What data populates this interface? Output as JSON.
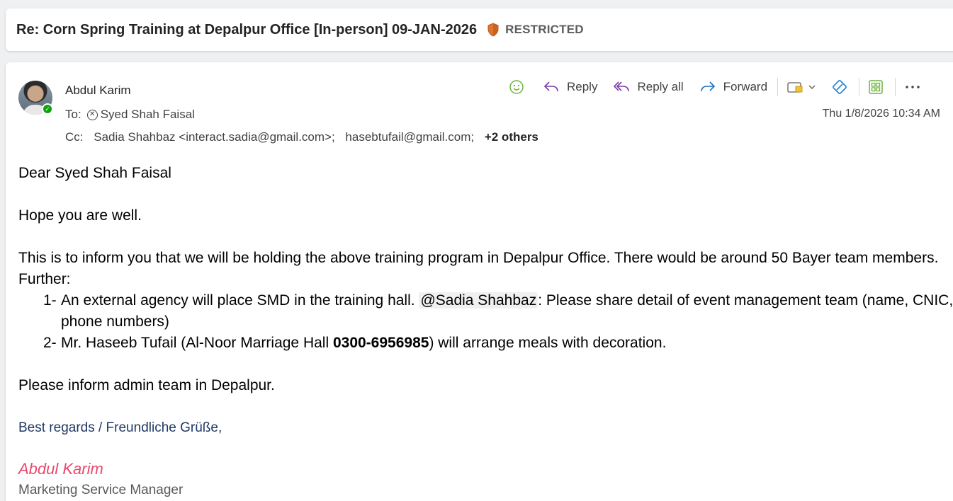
{
  "subject": {
    "title": "Re: Corn Spring Training at Depalpur Office [In-person] 09-JAN-2026",
    "label": "RESTRICTED"
  },
  "header": {
    "sender": "Abdul Karim",
    "to_prefix": "To:",
    "to_name": "Syed Shah Faisal",
    "cc_prefix": "Cc:",
    "cc": [
      "Sadia Shahbaz <interact.sadia@gmail.com>;",
      "hasebtufail@gmail.com;"
    ],
    "cc_more": "+2 others",
    "timestamp": "Thu 1/8/2026 10:34 AM"
  },
  "toolbar": {
    "reply": "Reply",
    "reply_all": "Reply all",
    "forward": "Forward"
  },
  "body": {
    "greeting": "Dear Syed Shah Faisal",
    "line1": "Hope you are well.",
    "para1": "This is to inform you that we will be holding the above training program in Depalpur Office.  There would be around 50 Bayer team members.  Further:",
    "item1_num": "1-",
    "item1_a": "An external agency will place SMD in the training hall. ",
    "item1_mention": "@Sadia Shahbaz",
    "item1_b": ":  Please share detail of event management team (name, CNIC, phone numbers)",
    "item2_num": "2-",
    "item2_a": "Mr. Haseeb Tufail (Al-Noor Marriage Hall ",
    "item2_phone": "0300-6956985",
    "item2_b": ") will arrange meals with decoration.",
    "closing": "Please inform admin team in Depalpur."
  },
  "signature": {
    "regards": "Best regards / Freundliche Grüße,",
    "name": "Abdul Karim",
    "title": "Marketing Service Manager"
  },
  "colors": {
    "presence": "#13a10e",
    "shield": "#e0752d",
    "signature_name": "#e8496e",
    "regards": "#1f3864"
  }
}
